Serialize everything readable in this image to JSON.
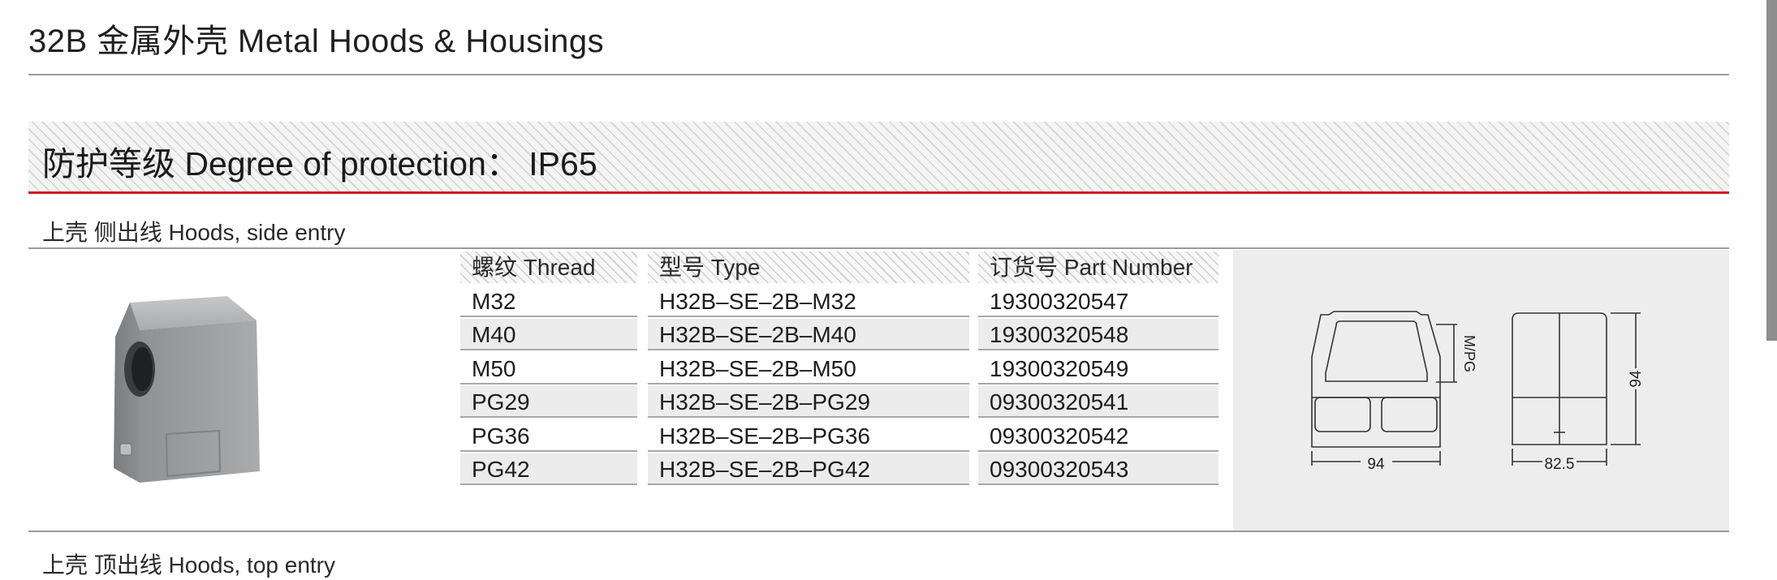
{
  "header": {
    "title": "32B 金属外壳  Metal Hoods & Housings"
  },
  "protection": {
    "text": "防护等级 Degree of protection： IP65"
  },
  "sections": [
    {
      "title": "上壳 侧出线  Hoods, side entry"
    },
    {
      "title": "上壳 顶出线  Hoods, top  entry"
    }
  ],
  "table": {
    "columns": [
      "螺纹 Thread",
      "型号 Type",
      "订货号 Part Number"
    ],
    "rows": [
      [
        "M32",
        "H32B–SE–2B–M32",
        "19300320547"
      ],
      [
        "M40",
        "H32B–SE–2B–M40",
        "19300320548"
      ],
      [
        "M50",
        "H32B–SE–2B–M50",
        "19300320549"
      ],
      [
        "PG29",
        "H32B–SE–2B–PG29",
        "09300320541"
      ],
      [
        "PG36",
        "H32B–SE–2B–PG36",
        "09300320542"
      ],
      [
        "PG42",
        "H32B–SE–2B–PG42",
        "09300320543"
      ]
    ]
  },
  "drawing": {
    "thread_label": "M/PG",
    "front_width": "94",
    "side_height": "94",
    "side_width": "82.5"
  }
}
